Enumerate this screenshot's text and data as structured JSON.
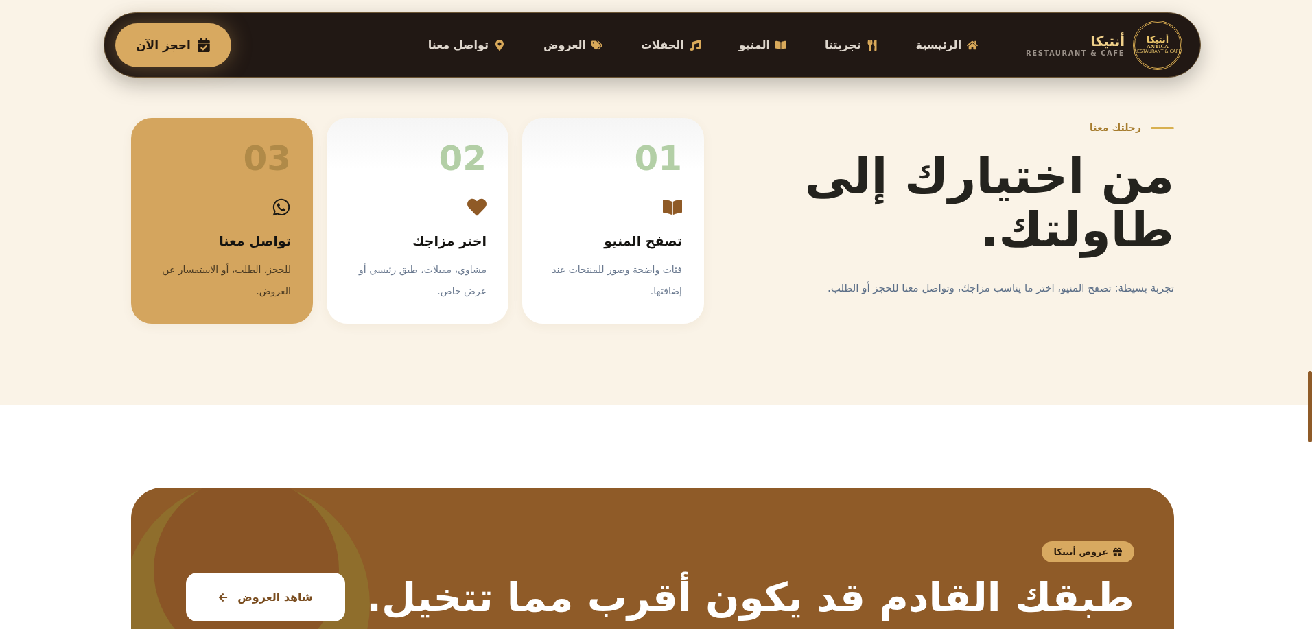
{
  "brand": {
    "name": "أنتيكا",
    "tagline": "RESTAURANT & CAFE",
    "seal_arabic": "أنتيكا",
    "seal_latin": "ANTICA",
    "seal_caption": "RESTAURANT & CAFE"
  },
  "nav": [
    {
      "label": "الرئيسية"
    },
    {
      "label": "تجربتنا"
    },
    {
      "label": "المنيو"
    },
    {
      "label": "الحفلات"
    },
    {
      "label": "العروض"
    },
    {
      "label": "تواصل معنا"
    }
  ],
  "cta": {
    "label": "احجز الآن"
  },
  "journey": {
    "eyebrow": "رحلتك معنا",
    "heading": "من اختيارك إلى طاولتك.",
    "text": "تجربة بسيطة: تصفح المنيو، اختر ما يناسب مزاجك، وتواصل معنا للحجز أو الطلب.",
    "steps": [
      {
        "number": "01",
        "title": "تصفح المنيو",
        "text": "فئات واضحة وصور للمنتجات عند إضافتها.",
        "highlighted": false
      },
      {
        "number": "02",
        "title": "اختر مزاجك",
        "text": "مشاوي، مقبلات، طبق رئيسي أو عرض خاص.",
        "highlighted": false
      },
      {
        "number": "03",
        "title": "تواصل معنا",
        "text": "للحجز، الطلب، أو الاستفسار عن العروض.",
        "highlighted": true
      }
    ]
  },
  "offers": {
    "badge": "عروض أنتيكا",
    "heading": "طبقك القادم قد يكون أقرب مما تتخيل.",
    "button": "شاهد العروض"
  }
}
